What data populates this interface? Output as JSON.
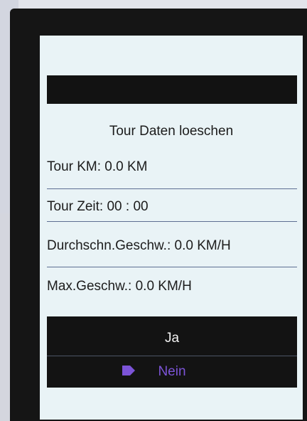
{
  "screen": {
    "title": "Tour Daten loeschen",
    "rows": [
      {
        "label": "Tour KM: 0.0 KM"
      },
      {
        "label": "Tour Zeit: 00 : 00"
      },
      {
        "label": "Durchschn.Geschw.: 0.0 KM/H"
      },
      {
        "label": "Max.Geschw.: 0.0 KM/H"
      }
    ],
    "menu": {
      "yes_label": "Ja",
      "no_label": "Nein",
      "selected": "Nein",
      "cursor_icon": "selection-pointer-icon"
    }
  },
  "colors": {
    "screen_background": "#e9f3f6",
    "bar_background": "#121212",
    "selected_text": "#7c54d8",
    "menu_text": "#f2f2f2",
    "separator": "#5d6e92"
  }
}
